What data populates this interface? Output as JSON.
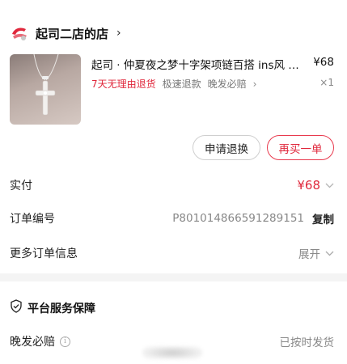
{
  "shop": {
    "name": "起司二店的店",
    "chevron": "›",
    "logo_icon": "shop-logo-icon"
  },
  "product": {
    "title": "起司 · 仲夏夜之梦十字架项链百搭 ins风 潮流吊坠",
    "price": "¥68",
    "quantity": "×1",
    "image_icon": "cross-necklace-image",
    "tags": {
      "return_policy": "7天无理由退货",
      "fast_refund": "极速退款",
      "late_compensation": "晚发必赔",
      "chevron": "›"
    }
  },
  "actions": {
    "refund_label": "申请退换",
    "rebuy_label": "再买一单"
  },
  "order_info": {
    "paid_label": "实付",
    "paid_value": "¥68",
    "order_no_label": "订单编号",
    "order_no_value": "P801014866591289151",
    "copy_label": "复制",
    "more_label": "更多订单信息",
    "expand_label": "展开"
  },
  "service": {
    "title": "平台服务保障",
    "late_label": "晚发必赔",
    "late_status": "已按时发货"
  },
  "colors": {
    "accent_red": "#e0283c",
    "text_primary": "#222222",
    "text_secondary": "#888888",
    "background": "#f4f4f4"
  }
}
